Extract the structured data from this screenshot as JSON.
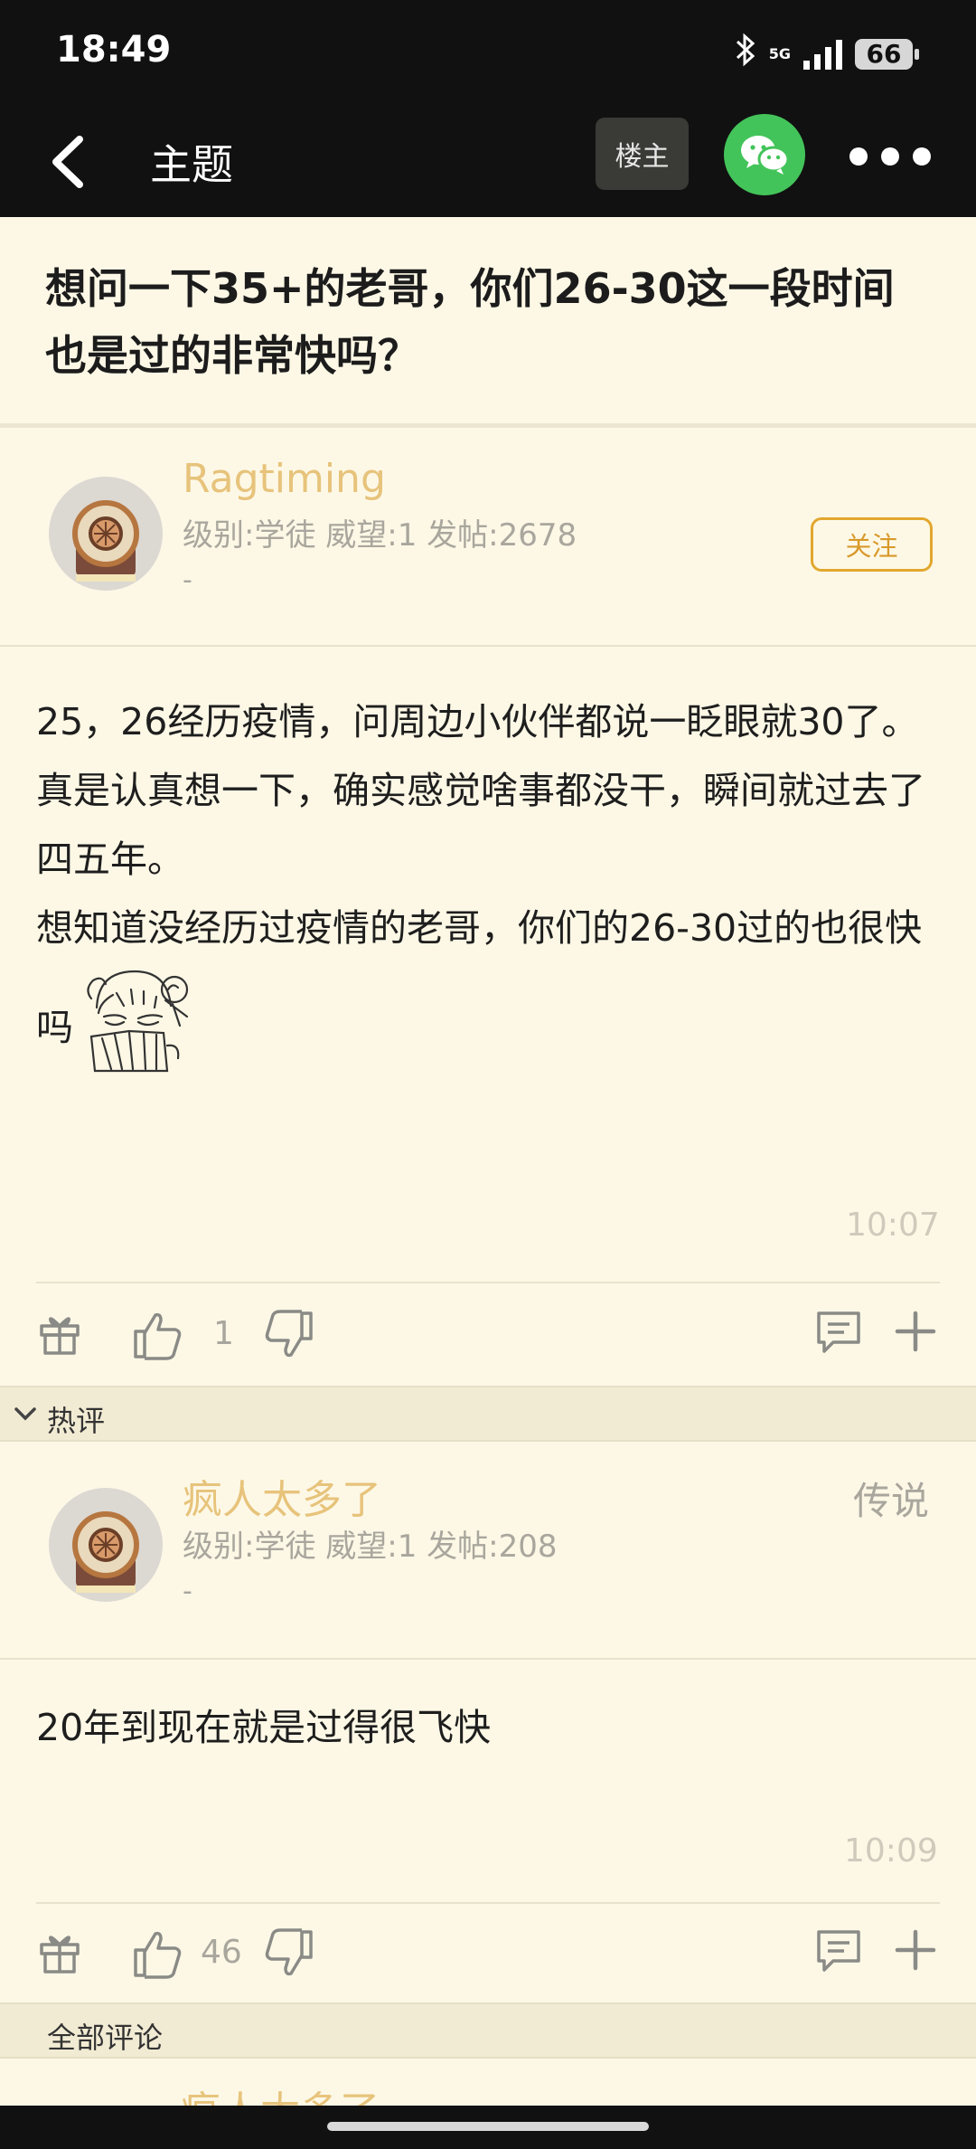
{
  "status_bar": {
    "time": "18:49",
    "network": "5G",
    "battery": "66"
  },
  "nav": {
    "title": "主题",
    "op_button": "楼主"
  },
  "thread": {
    "title": "想问一下35+的老哥，你们26-30这一段时间也是过的非常快吗？"
  },
  "op": {
    "username": "Ragtiming",
    "stats": "级别:学徒 威望:1 发帖:2678",
    "extra": "-",
    "follow_label": "关注",
    "body_lines": [
      "25，26经历疫情，问周边小伙伴都说一眨眼就30了。",
      "真是认真想一下，确实感觉啥事都没干，瞬间就过去了四五年。",
      "想知道没经历过疫情的老哥，你们的26-30过的也很快吗"
    ],
    "time": "10:07",
    "likes": "1"
  },
  "hot_section": {
    "label": "热评"
  },
  "hot_reply": {
    "username": "疯人太多了",
    "rank": "传说",
    "stats": "级别:学徒 威望:1 发帖:208",
    "extra": "-",
    "body": "20年到现在就是过得很飞快",
    "time": "10:09",
    "likes": "46"
  },
  "all_section": {
    "label": "全部评论"
  },
  "peek_username": "疯人太多了",
  "icons": [
    "back-arrow-icon",
    "wechat-icon",
    "more-icon",
    "gift-icon",
    "thumbs-up-icon",
    "thumbs-down-icon",
    "comment-icon",
    "plus-icon",
    "chevron-down-icon",
    "bluetooth-icon",
    "signal-icon",
    "battery-icon"
  ],
  "colors": {
    "background": "#fdf8e6",
    "username": "#e7c37b",
    "follow": "#e2a72e",
    "wechat": "#43c45a",
    "bar": "#111111"
  }
}
